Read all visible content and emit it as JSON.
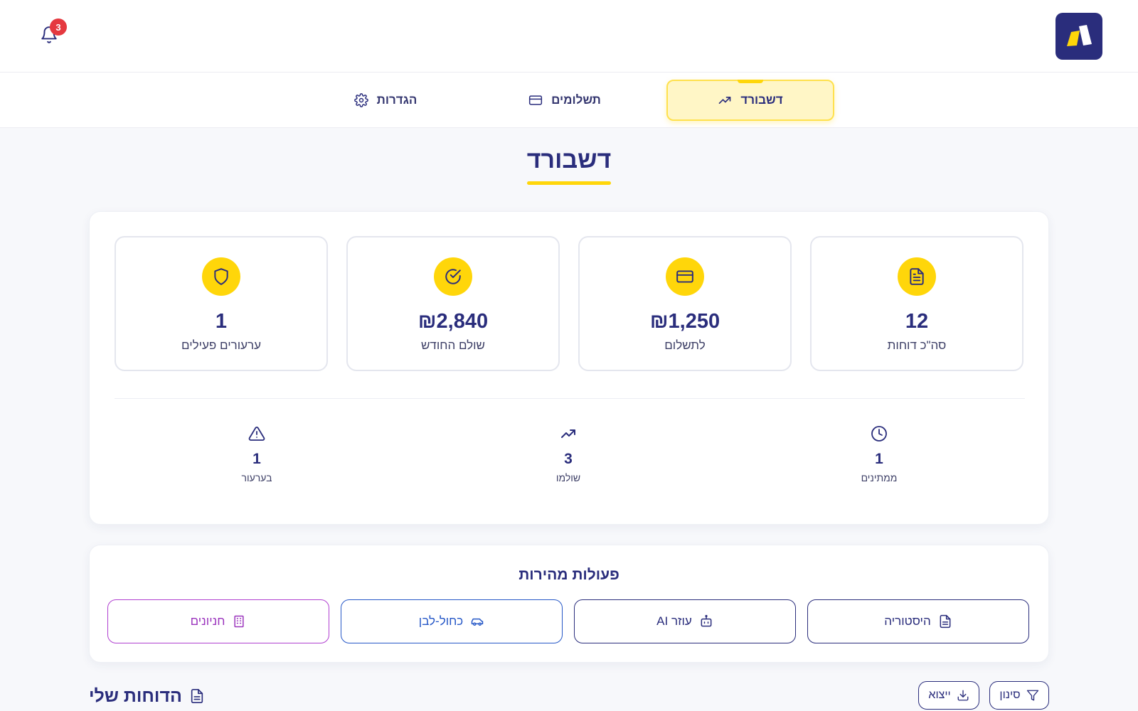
{
  "header": {
    "logo_icon": "brand-logo-icon",
    "notifications": {
      "icon": "bell-icon",
      "count": "3"
    }
  },
  "nav": {
    "tabs": [
      {
        "label": "דשבורד",
        "icon": "trending-up-icon",
        "active": true
      },
      {
        "label": "תשלומים",
        "icon": "credit-card-icon",
        "active": false
      },
      {
        "label": "הגדרות",
        "icon": "gear-icon",
        "active": false
      }
    ]
  },
  "page": {
    "title": "דשבורד"
  },
  "stats": {
    "cards": [
      {
        "value": "12",
        "label": "סה\"כ דוחות",
        "icon": "document-icon"
      },
      {
        "value": "₪1,250",
        "label": "לתשלום",
        "icon": "credit-card-icon"
      },
      {
        "value": "₪2,840",
        "label": "שולם החודש",
        "icon": "check-circle-icon"
      },
      {
        "value": "1",
        "label": "ערעורים פעילים",
        "icon": "shield-icon"
      }
    ],
    "mini": [
      {
        "value": "1",
        "label": "ממתינים",
        "icon": "clock-icon"
      },
      {
        "value": "3",
        "label": "שולמו",
        "icon": "trending-up-icon"
      },
      {
        "value": "1",
        "label": "בערעור",
        "icon": "warning-icon"
      }
    ]
  },
  "quick_actions": {
    "title": "פעולות מהירות",
    "buttons": [
      {
        "label": "היסטוריה",
        "icon": "document-icon"
      },
      {
        "label": "עוזר AI",
        "icon": "robot-icon"
      },
      {
        "label": "כחול-לבן",
        "icon": "car-icon"
      },
      {
        "label": "חניונים",
        "icon": "building-icon"
      }
    ]
  },
  "reports": {
    "title": "הדוחות שלי",
    "icon": "document-icon",
    "filter_label": "סינון",
    "export_label": "ייצוא"
  },
  "colors": {
    "brand_navy": "#2a2d7c",
    "accent_yellow": "#ffd60a",
    "badge_red": "#e53940",
    "action_blue": "#2557c7",
    "action_purple": "#b03fd0"
  }
}
